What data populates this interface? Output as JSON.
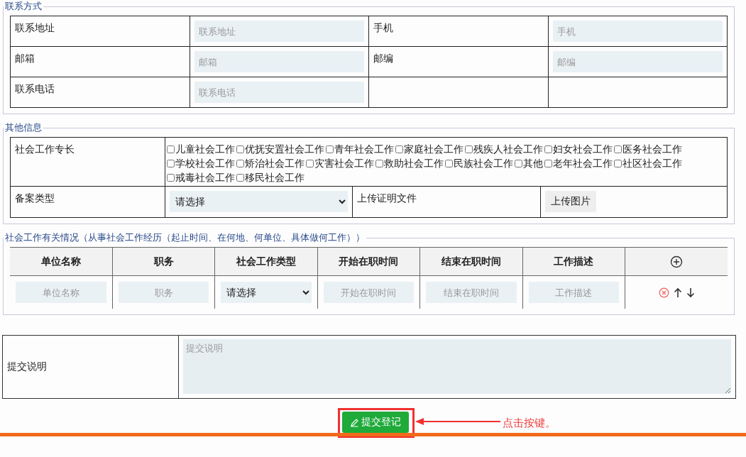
{
  "contact": {
    "legend": "联系方式",
    "rows": [
      [
        {
          "label": "联系地址",
          "placeholder": "联系地址"
        },
        {
          "label": "手机",
          "placeholder": "手机"
        }
      ],
      [
        {
          "label": "邮箱",
          "placeholder": "邮箱"
        },
        {
          "label": "邮编",
          "placeholder": "邮编"
        }
      ],
      [
        {
          "label": "联系电话",
          "placeholder": "联系电话"
        }
      ]
    ]
  },
  "other": {
    "legend": "其他信息",
    "specialty_label": "社会工作专长",
    "specialties": [
      {
        "label": "儿童社会工作",
        "checked": false
      },
      {
        "label": "优抚安置社会工作",
        "checked": false
      },
      {
        "label": "青年社会工作",
        "checked": false
      },
      {
        "label": "家庭社会工作",
        "checked": false
      },
      {
        "label": "残疾人社会工作",
        "checked": false
      },
      {
        "label": "妇女社会工作",
        "checked": false
      },
      {
        "label": "医务社会工作",
        "checked": false
      },
      {
        "label": "学校社会工作",
        "checked": false
      },
      {
        "label": "矫治社会工作",
        "checked": false
      },
      {
        "label": "灾害社会工作",
        "checked": false
      },
      {
        "label": "救助社会工作",
        "checked": false
      },
      {
        "label": "民族社会工作",
        "checked": false
      },
      {
        "label": "其他",
        "checked": false
      },
      {
        "label": "老年社会工作",
        "checked": false
      },
      {
        "label": "社区社会工作",
        "checked": false
      },
      {
        "label": "戒毒社会工作",
        "checked": false
      },
      {
        "label": "移民社会工作",
        "checked": false
      }
    ],
    "filing_type": {
      "label": "备案类型",
      "value": "请选择"
    },
    "upload": {
      "label": "上传证明文件",
      "button": "上传图片"
    }
  },
  "experience": {
    "legend": "社会工作有关情况（从事社会工作经历（起止时间、在何地、何单位、具体做何工作））",
    "columns": [
      "单位名称",
      "职务",
      "社会工作类型",
      "开始在职时间",
      "结束在职时间",
      "工作描述"
    ],
    "row": [
      {
        "kind": "input",
        "placeholder": "单位名称"
      },
      {
        "kind": "input",
        "placeholder": "职务"
      },
      {
        "kind": "select",
        "value": "请选择"
      },
      {
        "kind": "input",
        "placeholder": "开始在职时间"
      },
      {
        "kind": "input",
        "placeholder": "结束在职时间"
      },
      {
        "kind": "input",
        "placeholder": "工作描述"
      }
    ]
  },
  "submit_note": {
    "label": "提交说明",
    "placeholder": "提交说明"
  },
  "submit_button": {
    "label": "提交登记"
  },
  "annotation": "点击按键。"
}
